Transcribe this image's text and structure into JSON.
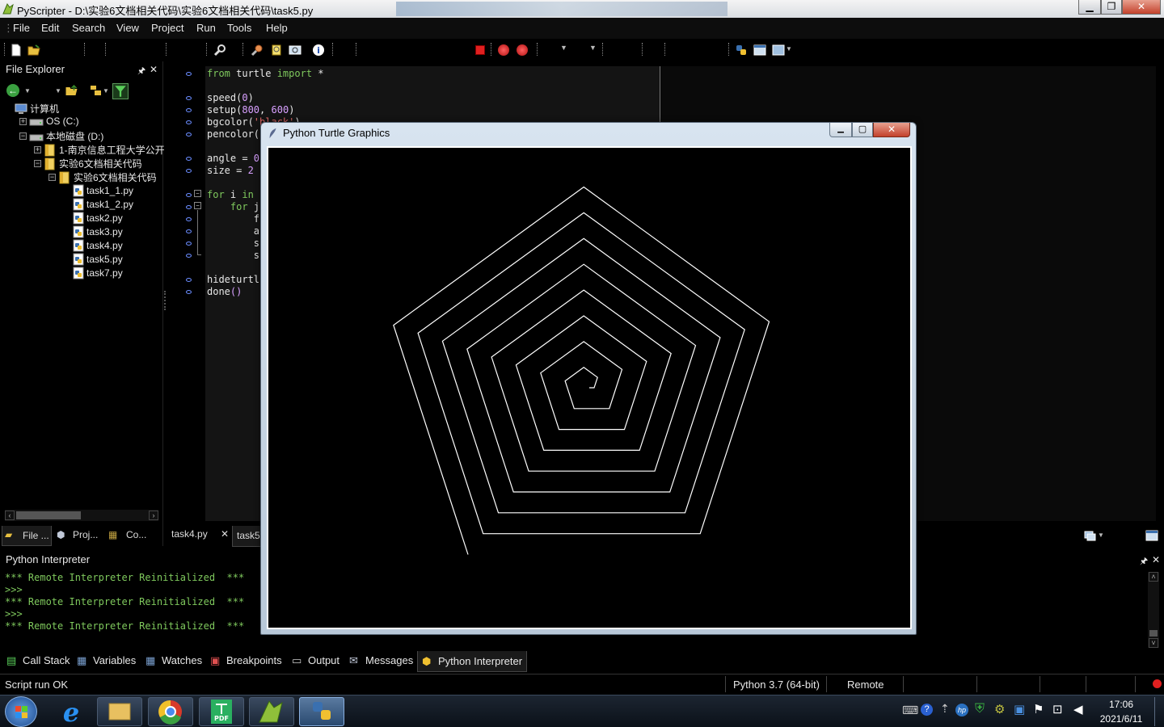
{
  "window": {
    "title": "PyScripter - D:\\实验6文档相关代码\\实验6文档相关代码\\task5.py",
    "minimize": "▁",
    "maximize": "❐",
    "close": "✕"
  },
  "menu": [
    "File",
    "Edit",
    "Search",
    "View",
    "Project",
    "Run",
    "Tools",
    "Help"
  ],
  "file_explorer": {
    "title": "File Explorer",
    "pin": "🖈",
    "close": "✕",
    "tree": [
      {
        "label": "计算机",
        "icon": "computer-icon",
        "depth": 0,
        "expander": ""
      },
      {
        "label": "OS (C:)",
        "icon": "drive-icon",
        "depth": 1,
        "expander": "+"
      },
      {
        "label": "本地磁盘 (D:)",
        "icon": "drive-icon",
        "depth": 1,
        "expander": "−"
      },
      {
        "label": "1-南京信息工程大学公开",
        "icon": "folder-icon",
        "depth": 2,
        "expander": "+"
      },
      {
        "label": "实验6文档相关代码",
        "icon": "folder-icon",
        "depth": 2,
        "expander": "−"
      },
      {
        "label": "实验6文档相关代码",
        "icon": "folder-icon",
        "depth": 3,
        "expander": "−"
      },
      {
        "label": "task1_1.py",
        "icon": "python-file-icon",
        "depth": 4,
        "expander": ""
      },
      {
        "label": "task1_2.py",
        "icon": "python-file-icon",
        "depth": 4,
        "expander": ""
      },
      {
        "label": "task2.py",
        "icon": "python-file-icon",
        "depth": 4,
        "expander": ""
      },
      {
        "label": "task3.py",
        "icon": "python-file-icon",
        "depth": 4,
        "expander": ""
      },
      {
        "label": "task4.py",
        "icon": "python-file-icon",
        "depth": 4,
        "expander": ""
      },
      {
        "label": "task5.py",
        "icon": "python-file-icon",
        "depth": 4,
        "expander": ""
      },
      {
        "label": "task7.py",
        "icon": "python-file-icon",
        "depth": 4,
        "expander": ""
      }
    ],
    "bottom_tabs": [
      "File ...",
      "Proj...",
      "Co..."
    ]
  },
  "editor": {
    "lines": [
      {
        "tokens": [
          {
            "t": "from",
            "c": "kw"
          },
          {
            "t": " turtle ",
            "c": ""
          },
          {
            "t": "import",
            "c": "kw"
          },
          {
            "t": " *",
            "c": ""
          }
        ],
        "dot": true
      },
      {
        "tokens": [],
        "dot": false
      },
      {
        "tokens": [
          {
            "t": "speed(",
            "c": ""
          },
          {
            "t": "0",
            "c": "num"
          },
          {
            "t": ")",
            "c": ""
          }
        ],
        "dot": true
      },
      {
        "tokens": [
          {
            "t": "setup(",
            "c": ""
          },
          {
            "t": "800",
            "c": "num"
          },
          {
            "t": ", ",
            "c": ""
          },
          {
            "t": "600",
            "c": "num"
          },
          {
            "t": ")",
            "c": ""
          }
        ],
        "dot": true
      },
      {
        "tokens": [
          {
            "t": "bgcolor(",
            "c": ""
          },
          {
            "t": "'black'",
            "c": "str"
          },
          {
            "t": ")",
            "c": ""
          }
        ],
        "dot": true
      },
      {
        "tokens": [
          {
            "t": "pencolor(",
            "c": ""
          }
        ],
        "dot": true
      },
      {
        "tokens": [],
        "dot": false
      },
      {
        "tokens": [
          {
            "t": "angle = ",
            "c": ""
          },
          {
            "t": "0",
            "c": "num"
          }
        ],
        "dot": true
      },
      {
        "tokens": [
          {
            "t": "size = ",
            "c": ""
          },
          {
            "t": "2",
            "c": "num"
          }
        ],
        "dot": true
      },
      {
        "tokens": [],
        "dot": false
      },
      {
        "tokens": [
          {
            "t": "for",
            "c": "kw"
          },
          {
            "t": " i ",
            "c": ""
          },
          {
            "t": "in",
            "c": "kw"
          }
        ],
        "dot": true
      },
      {
        "tokens": [
          {
            "t": "    ",
            "c": ""
          },
          {
            "t": "for",
            "c": "kw"
          },
          {
            "t": " j",
            "c": ""
          }
        ],
        "dot": true
      },
      {
        "tokens": [
          {
            "t": "        f",
            "c": ""
          }
        ],
        "dot": true
      },
      {
        "tokens": [
          {
            "t": "        a",
            "c": ""
          }
        ],
        "dot": true
      },
      {
        "tokens": [
          {
            "t": "        s",
            "c": ""
          }
        ],
        "dot": true
      },
      {
        "tokens": [
          {
            "t": "        s",
            "c": ""
          }
        ],
        "dot": true
      },
      {
        "tokens": [],
        "dot": false
      },
      {
        "tokens": [
          {
            "t": "hideturtl",
            "c": ""
          }
        ],
        "dot": true
      },
      {
        "tokens": [
          {
            "t": "done",
            "c": ""
          },
          {
            "t": "()",
            "c": "num"
          }
        ],
        "dot": true
      }
    ],
    "tabs": [
      "task4.py",
      "task5"
    ],
    "tab_close": "✕"
  },
  "turtle_window": {
    "title": "Python Turtle Graphics",
    "minimize": "▁",
    "maximize": "▢",
    "close": "✕",
    "drawing": {
      "sides": 5,
      "turn_angle": 72,
      "pen_color": "#ffffff",
      "background": "#000000"
    }
  },
  "interpreter": {
    "title": "Python Interpreter",
    "lines": [
      "*** Remote Interpreter Reinitialized  ***",
      ">>>",
      "*** Remote Interpreter Reinitialized  ***",
      ">>>",
      "*** Remote Interpreter Reinitialized  ***"
    ],
    "pin": "🖈",
    "close": "✕"
  },
  "bottom_tabs": [
    "Call Stack",
    "Variables",
    "Watches",
    "Breakpoints",
    "Output",
    "Messages",
    "Python Interpreter"
  ],
  "status": {
    "message": "Script run OK",
    "python_version": "Python 3.7 (64-bit)",
    "engine": "Remote"
  },
  "taskbar": {
    "time": "17:06",
    "date": "2021/6/11",
    "apps": [
      "start-orb",
      "internet-explorer",
      "file-explorer",
      "chrome",
      "pdf-reader",
      "pyscripter",
      "python-turtle"
    ]
  },
  "colors": {
    "keyword": "#7fc95d",
    "number": "#d8a0ff",
    "string": "#e86a6a",
    "breakpoint_dot": "#6a8cff",
    "stop_red": "#e02020"
  }
}
